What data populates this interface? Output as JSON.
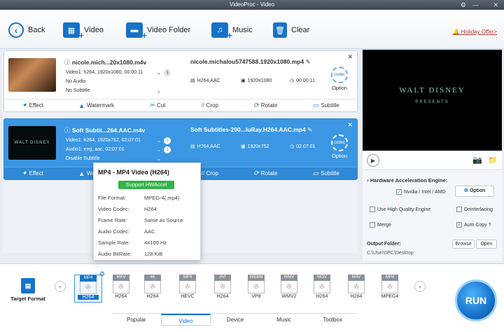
{
  "window": {
    "title": "VideoProc - Video"
  },
  "toolbar": {
    "back": "Back",
    "video": "Video",
    "video_folder": "Video Folder",
    "music": "Music",
    "clear": "Clear",
    "holiday": "Holiday Offer>"
  },
  "items": [
    {
      "name": "nicole.mich...20x1080.m4v",
      "video_info": "Video1: h264, 1920x1080, 00:00:11",
      "audio_info": "No Audio",
      "subtitle_info": "No Subtitle",
      "video_num": "1",
      "output_name": "nicole.michalou5747588.1920x1080.mp4",
      "codec": "H264,AAC",
      "resolution": "1920x1080",
      "duration": "00:00:11",
      "option": "Option",
      "codec_badge": "codec"
    },
    {
      "name": "Soft Subtit...264.AAC.m4v",
      "video_info": "Video1: h264, 1920x752, 02:07:01",
      "audio_info": "Audio1: eng, aac, 02:07:01",
      "subtitle_info": "Disable Subtitle",
      "video_num": "1",
      "audio_num": "1",
      "output_name": "Soft Subtitles-200...luRay.H264.AAC.mp4",
      "codec": "H264,AAC",
      "resolution": "1920x752",
      "duration": "02:07:01",
      "option": "Option",
      "codec_badge": "codec",
      "thumb_text": "WALT DISNEY"
    }
  ],
  "actions": {
    "effect": "Effect",
    "watermark": "Watermark",
    "cut": "Cut",
    "crop": "Crop",
    "rotate": "Rotate",
    "subtitle": "Subtitle"
  },
  "preview": {
    "title": "WALT DISNEY",
    "subtitle": "PRESENTS"
  },
  "side": {
    "hw_label": "Hardware Acceleration Engine:",
    "nvidia": "Nvidia / Intel / AMD",
    "option": "Option",
    "hq_engine": "Use High Quality Engine",
    "deinterlacing": "Deinterlacing",
    "merge": "Merge",
    "auto_copy": "Auto Copy",
    "auto_copy_help": "?",
    "output_folder": "Output Folder:",
    "browse": "Browse",
    "open": "Open",
    "path": "C:\\Users\\PC\\Desktop"
  },
  "popup": {
    "title": "MP4 - MP4 Video (H264)",
    "hwaccel": "Support HWAccel",
    "rows": [
      {
        "k": "File Format:",
        "v": "MPEG-4(.mp4)"
      },
      {
        "k": "Video Codec:",
        "v": "H264"
      },
      {
        "k": "Frame Rate:",
        "v": "Same as Source"
      },
      {
        "k": "Audio Codec:",
        "v": "AAC"
      },
      {
        "k": "Sample Rate:",
        "v": "44100 Hz"
      },
      {
        "k": "Audio BitRate:",
        "v": "128 KiB"
      }
    ]
  },
  "target_format": "Target Format",
  "formats": [
    {
      "top": "MP4",
      "bot": "H264"
    },
    {
      "top": "MKV",
      "bot": "H264"
    },
    {
      "top": "4K",
      "bot": "H264"
    },
    {
      "top": "MP4",
      "bot": "HEVC"
    },
    {
      "top": "AVI",
      "bot": "H264"
    },
    {
      "top": "WEBM",
      "bot": "VP8"
    },
    {
      "top": "WMV",
      "bot": "WMV2"
    },
    {
      "top": "MOV",
      "bot": "H264"
    },
    {
      "top": "M4V",
      "bot": "H264"
    },
    {
      "top": "MP4",
      "bot": "MPEG4"
    }
  ],
  "tabs": [
    "Popular",
    "Video",
    "Device",
    "Music",
    "Toolbox"
  ],
  "run": "RUN",
  "colors": {
    "accent": "#1673c9",
    "selected_row": "#3b97e3",
    "hw_green": "#33b34a",
    "holiday": "#b03a2e"
  }
}
